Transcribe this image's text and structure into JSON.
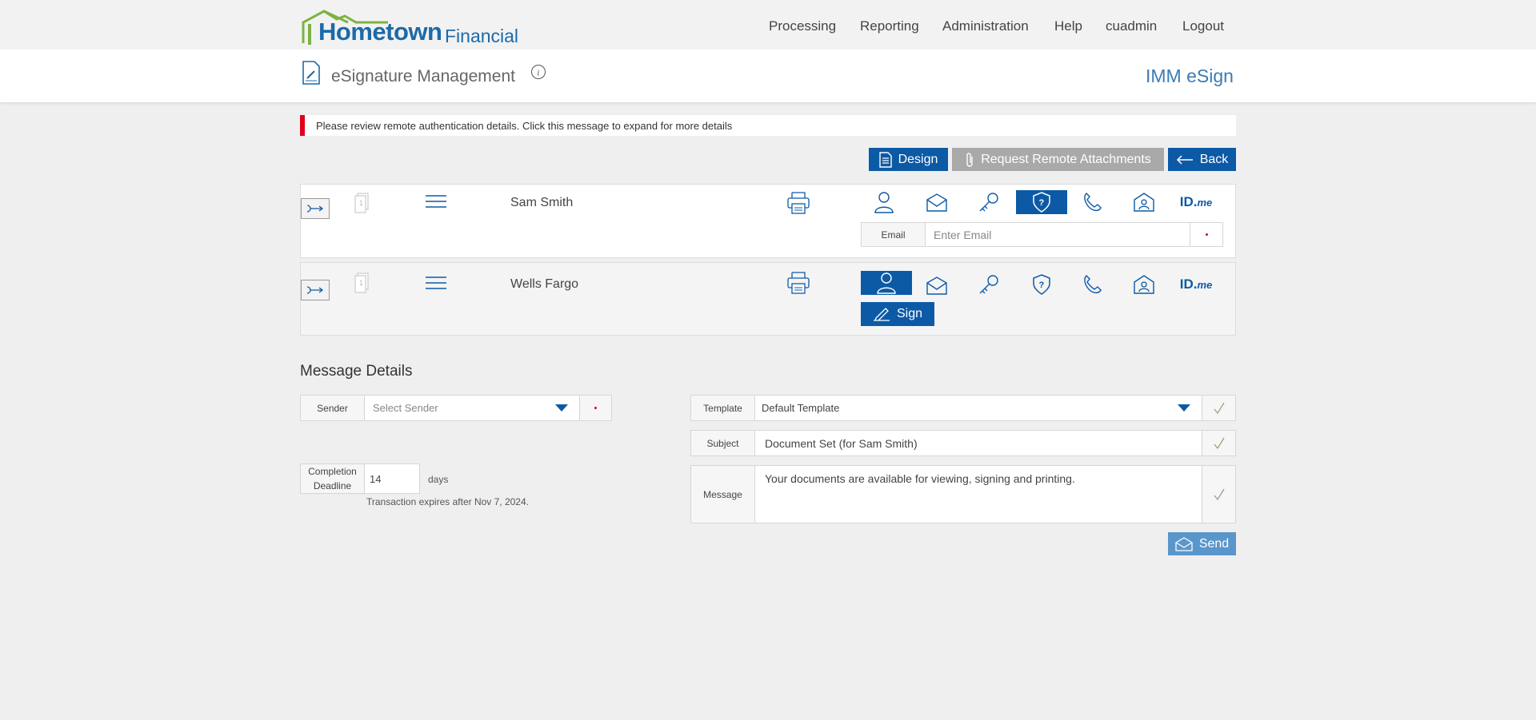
{
  "brand": {
    "name_bold": "Hometown",
    "name_light": "Financial"
  },
  "nav": [
    "Processing",
    "Reporting",
    "Administration",
    "Help",
    "cuadmin",
    "Logout"
  ],
  "header": {
    "title": "eSignature Management",
    "product": "IMM eSign"
  },
  "alert": {
    "text": "Please review remote authentication details. Click this message to expand for more details"
  },
  "actions": {
    "design": "Design",
    "request_attachments": "Request Remote Attachments",
    "back": "Back"
  },
  "recipients": [
    {
      "page_count": "1",
      "name": "Sam Smith",
      "active_auth": "kba",
      "email_label": "Email",
      "email_placeholder": "Enter Email"
    },
    {
      "page_count": "1",
      "name": "Wells Fargo",
      "active_auth": "in-person",
      "sign_label": "Sign"
    }
  ],
  "auth_methods": [
    {
      "key": "in-person",
      "icon": "person-icon"
    },
    {
      "key": "email",
      "icon": "envelope-icon"
    },
    {
      "key": "password",
      "icon": "key-icon"
    },
    {
      "key": "kba",
      "icon": "shield-question-icon"
    },
    {
      "key": "phone",
      "icon": "phone-icon"
    },
    {
      "key": "id-check",
      "icon": "id-card-icon"
    },
    {
      "key": "idme",
      "icon": "idme-logo",
      "label_main": "ID.",
      "label_sub": "me"
    }
  ],
  "message_details": {
    "title": "Message Details",
    "sender_label": "Sender",
    "sender_placeholder": "Select Sender",
    "completion_label_1": "Completion",
    "completion_label_2": "Deadline",
    "completion_days": "14",
    "days_label": "days",
    "expires_text": "Transaction expires after Nov 7, 2024.",
    "template_label": "Template",
    "template_value": "Default Template",
    "subject_label": "Subject",
    "subject_value": "Document Set (for Sam Smith)",
    "message_label": "Message",
    "message_value": "Your documents are available for viewing, signing and printing.",
    "send_label": "Send"
  },
  "colors": {
    "primary": "#0c5aa6",
    "alert": "#e0001b",
    "logo_green": "#7cb342",
    "check": "#8aa07a"
  }
}
